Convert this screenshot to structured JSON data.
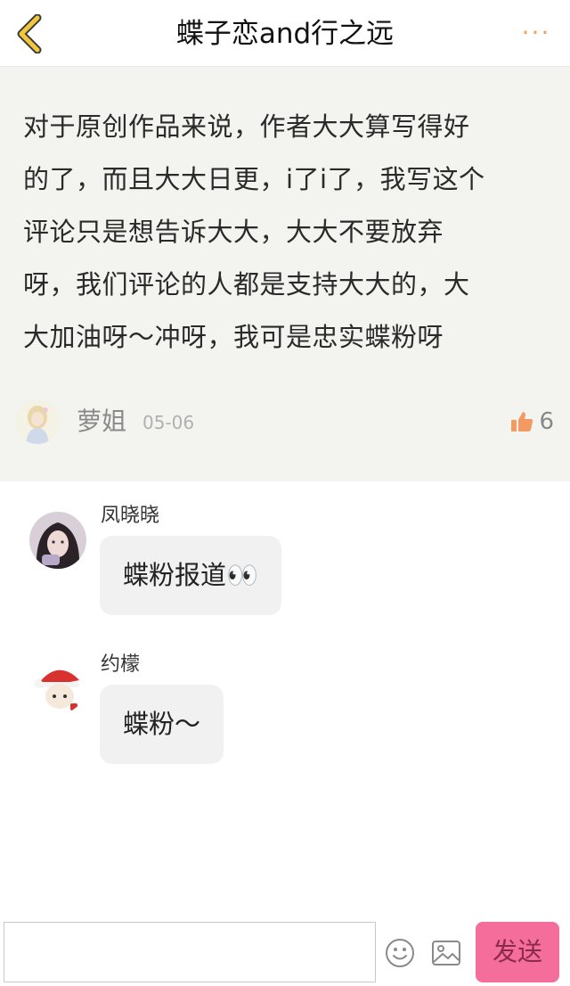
{
  "header": {
    "title": "蝶子恋and行之远",
    "back_icon": "chevron-left-icon",
    "more_label": "···",
    "accent_color": "#f3c73c"
  },
  "comment": {
    "text": "对于原创作品来说，作者大大算写得好\n的了，而且大大日更，i了i了，我写这个\n评论只是想告诉大大，大大不要放弃\n呀，我们评论的人都是支持大大的，大\n大加油呀～冲呀，我可是忠实蝶粉呀",
    "author": "萝姐",
    "date": "05-06",
    "likes": "6",
    "like_color": "#f39a63"
  },
  "replies": [
    {
      "name": "凤晓晓",
      "text": "蝶粉报道👀"
    },
    {
      "name": "约檬",
      "text": "蝶粉～"
    }
  ],
  "bottom": {
    "input_placeholder": "",
    "send_label": "发送",
    "send_color": "#f56e9b"
  }
}
